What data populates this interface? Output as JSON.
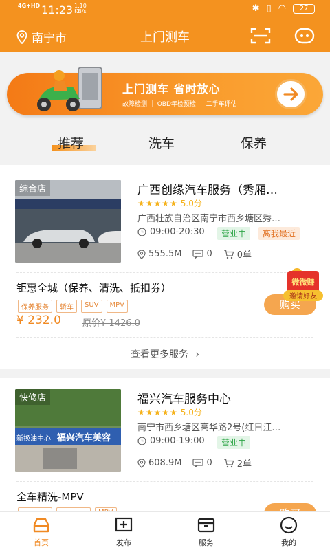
{
  "status_bar": {
    "network": "4G+HD",
    "time": "11:23",
    "speed": "1.10\nKB/s",
    "battery": "27"
  },
  "header": {
    "city": "南宁市",
    "title": "上门测车"
  },
  "banner": {
    "title": "上门测车 省时放心",
    "subtitle": "故障检测 ｜ OBD年检预检 ｜ 二手车评估"
  },
  "tabs": [
    "推荐",
    "洗车",
    "保养"
  ],
  "shops": [
    {
      "tag": "综合店",
      "name": "广西创缘汽车服务（秀厢…",
      "stars": "★★★★★",
      "score": "5.0分",
      "address": "广西壮族自治区南宁市西乡塘区秀…",
      "hours": "09:00-20:30",
      "open_badge": "营业中",
      "near_badge": "离我最近",
      "distance": "555.5M",
      "comments": "0",
      "orders": "0单",
      "package": {
        "title": "钜惠全城（保养、清洗、抵扣券）",
        "chips": [
          "保养服务",
          "轿车",
          "SUV",
          "MPV"
        ],
        "price": "¥ 232.0",
        "original": "原价¥ 1426.0",
        "buy": "购买"
      },
      "more": "查看更多服务"
    },
    {
      "tag": "快修店",
      "name": "福兴汽车服务中心",
      "stars": "★★★★★",
      "score": "5.0分",
      "address": "南宁市西乡塘区高华路2号(红日江…",
      "hours": "09:00-19:00",
      "open_badge": "营业中",
      "distance": "608.9M",
      "comments": "0",
      "orders": "2单",
      "package": {
        "title": "全车精洗-MPV",
        "chips": [
          "洗车美容",
          "全车精洗",
          "MPV"
        ],
        "buy": "购买"
      }
    }
  ],
  "invite": {
    "top": "微微赚",
    "bottom": "邀请好友"
  },
  "nav": [
    "首页",
    "发布",
    "服务",
    "我的"
  ],
  "colors": {
    "brand": "#f4921f",
    "open_green": "#2fa648",
    "price": "#f08a24"
  }
}
